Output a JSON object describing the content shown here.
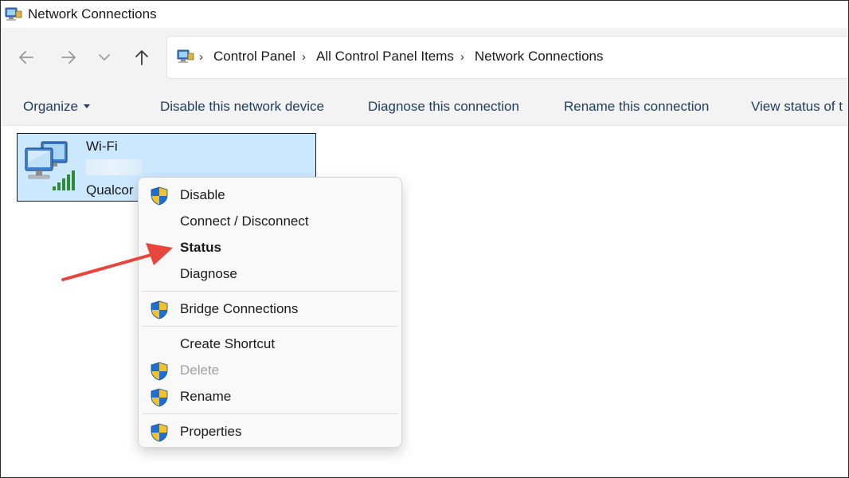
{
  "window": {
    "title": "Network Connections"
  },
  "nav": {
    "back_icon": "arrow-left-icon",
    "forward_icon": "arrow-right-icon",
    "recent_icon": "chevron-down-icon",
    "up_icon": "arrow-up-icon"
  },
  "breadcrumb": {
    "items": [
      "Control Panel",
      "All Control Panel Items",
      "Network Connections"
    ]
  },
  "toolbar": {
    "organize": "Organize",
    "disable": "Disable this network device",
    "diagnose": "Diagnose this connection",
    "rename": "Rename this connection",
    "view_status": "View status of t"
  },
  "connection": {
    "name": "Wi-Fi",
    "adapter": "Qualcor",
    "icon": "network-computer-wifi-icon"
  },
  "context_menu": {
    "items": [
      {
        "label": "Disable",
        "shield": true,
        "bold": false,
        "disabled": false
      },
      {
        "label": "Connect / Disconnect",
        "shield": false,
        "bold": false,
        "disabled": false
      },
      {
        "label": "Status",
        "shield": false,
        "bold": true,
        "disabled": false
      },
      {
        "label": "Diagnose",
        "shield": false,
        "bold": false,
        "disabled": false
      },
      {
        "label": "Bridge Connections",
        "shield": true,
        "bold": false,
        "disabled": false
      },
      {
        "label": "Create Shortcut",
        "shield": false,
        "bold": false,
        "disabled": false
      },
      {
        "label": "Delete",
        "shield": true,
        "bold": false,
        "disabled": true
      },
      {
        "label": "Rename",
        "shield": true,
        "bold": false,
        "disabled": false
      },
      {
        "label": "Properties",
        "shield": true,
        "bold": false,
        "disabled": false
      }
    ]
  },
  "annotation": {
    "arrow_color": "#e8453c",
    "points_to": "Status"
  },
  "colors": {
    "selection": "#cce8ff",
    "toolbar_bg": "#f3f3f3",
    "menu_bg": "#f9f9f9",
    "disabled_text": "#a0a0a0"
  }
}
